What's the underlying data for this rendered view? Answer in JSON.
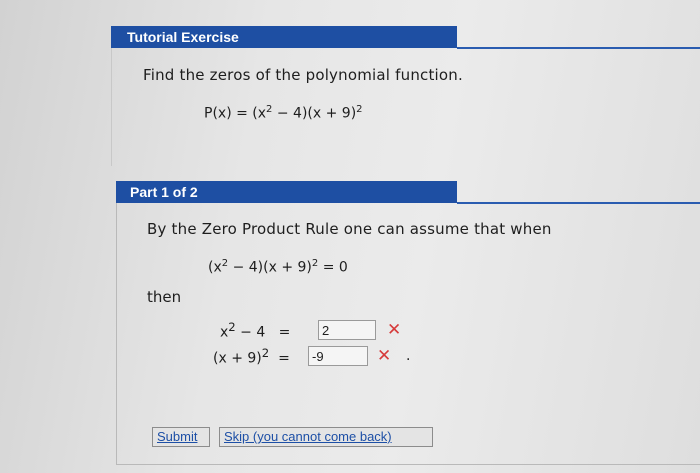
{
  "tutorial": {
    "title": "Tutorial Exercise",
    "prompt": "Find the zeros of the polynomial function."
  },
  "function_eq": {
    "lhs": "P(x) = (x",
    "exp1": "2",
    "mid": " − 4)(x + 9)",
    "exp2": "2"
  },
  "part": {
    "title": "Part 1 of 2",
    "intro": "By the Zero Product Rule one can assume that when",
    "eq": {
      "a": "(x",
      "exp1": "2",
      "b": " − 4)(x + 9)",
      "exp2": "2",
      "c": " = 0"
    },
    "then": "then",
    "rows": [
      {
        "a": "x",
        "exp": "2",
        "b": " − 4   =",
        "answer": "2"
      },
      {
        "a": "(x + 9)",
        "exp": "2",
        "b": "  =",
        "answer": "-9"
      }
    ]
  },
  "buttons": {
    "submit": "Submit",
    "skip": "Skip (you cannot come back)"
  },
  "colors": {
    "header_blue": "#1e4fa3",
    "incorrect_red": "#d63a3a"
  }
}
